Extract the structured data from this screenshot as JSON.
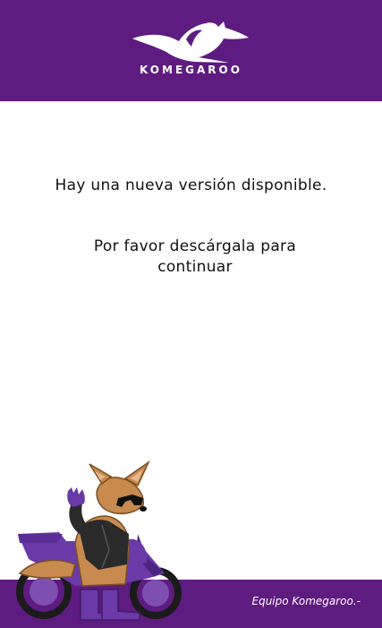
{
  "header": {
    "brand_name": "KOMEGAROO",
    "logo_icon": "kangaroo-logo-icon"
  },
  "message": {
    "line1": "Hay una nueva versión disponible.",
    "line2": "Por favor descárgala para continuar"
  },
  "footer": {
    "signature": "Equipo Komegaroo.-"
  },
  "illustration": {
    "icon": "kangaroo-motorcycle-mascot"
  },
  "colors": {
    "brand_purple": "#5e1b80",
    "text": "#111111",
    "background": "#ffffff"
  }
}
